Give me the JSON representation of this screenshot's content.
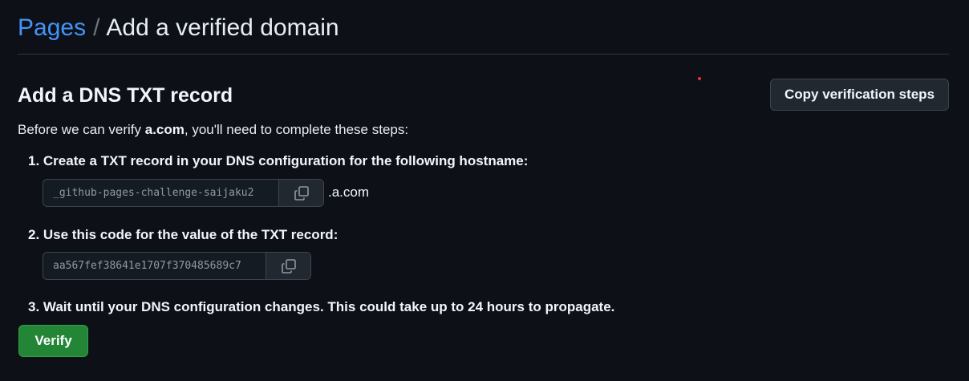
{
  "breadcrumb": {
    "parent": "Pages",
    "separator": "/",
    "current": "Add a verified domain"
  },
  "section": {
    "title": "Add a DNS TXT record",
    "copy_button": "Copy verification steps"
  },
  "intro": {
    "prefix": "Before we can verify ",
    "domain": "a.com",
    "suffix": ", you'll need to complete these steps:"
  },
  "steps": [
    {
      "text": "1. Create a TXT record in your DNS configuration for the following hostname:",
      "value": "_github-pages-challenge-saijaku2",
      "value_suffix": ".a.com",
      "copy_icon": "copy-icon"
    },
    {
      "text": "2. Use this code for the value of the TXT record:",
      "value": "aa567fef38641e1707f370485689c7",
      "copy_icon": "copy-icon"
    },
    {
      "text": "3. Wait until your DNS configuration changes. This could take up to 24 hours to propagate."
    }
  ],
  "verify_button": "Verify",
  "colors": {
    "background": "#0d1117",
    "link": "#4493f8",
    "primary_button": "#238636",
    "border": "#30363d"
  }
}
